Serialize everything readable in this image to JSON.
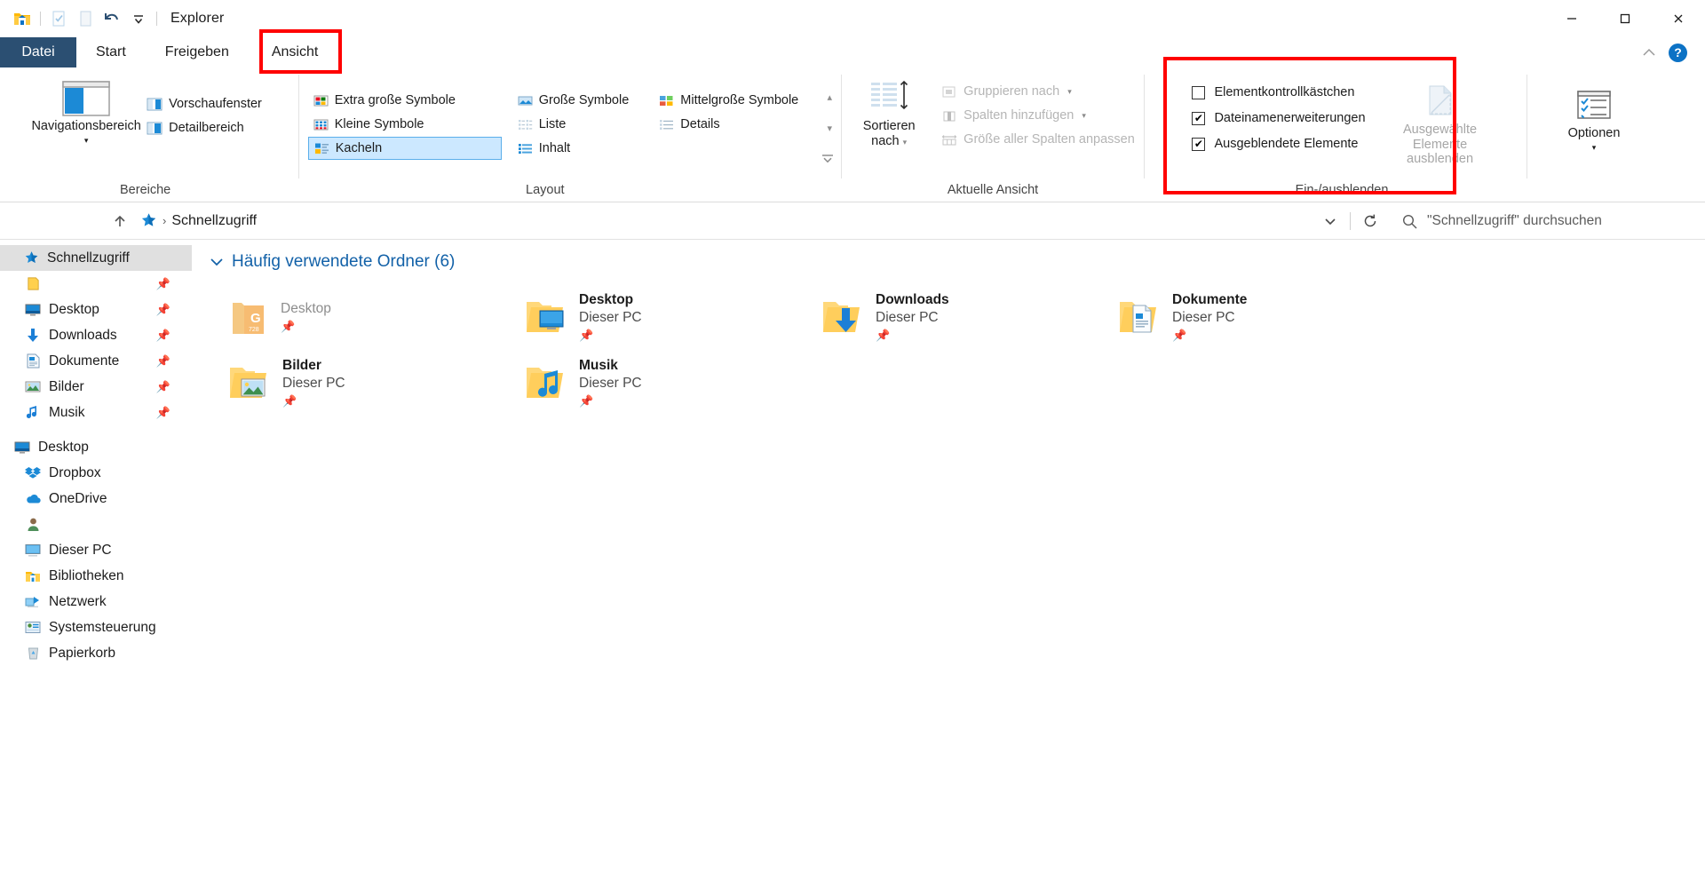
{
  "window": {
    "title": "Explorer",
    "quick_access_toolbar": [
      {
        "name": "explorer-icon",
        "label": "Explorer"
      },
      {
        "name": "properties-icon",
        "label": "Eigenschaften"
      },
      {
        "name": "new-folder-icon",
        "label": "Neuer Ordner"
      },
      {
        "name": "undo-icon",
        "label": "Rückgängig"
      },
      {
        "name": "customize-qat-caret",
        "label": "Symbolleiste anpassen"
      }
    ],
    "controls": {
      "minimize": "—",
      "maximize": "☐",
      "close": "✕"
    }
  },
  "tabs": [
    {
      "id": "datei",
      "label": "Datei",
      "kind": "file"
    },
    {
      "id": "start",
      "label": "Start",
      "kind": "normal"
    },
    {
      "id": "freigeben",
      "label": "Freigeben",
      "kind": "normal"
    },
    {
      "id": "ansicht",
      "label": "Ansicht",
      "kind": "normal",
      "highlighted": true
    }
  ],
  "tab_right": {
    "collapse_ribbon_caret": "⌃",
    "help_label": "?"
  },
  "ribbon": {
    "groups": [
      {
        "id": "bereiche",
        "label": "Bereiche",
        "big_button": {
          "label": "Navigationsbereich",
          "caret": "▾",
          "icon": "navigation-pane-icon"
        },
        "small_buttons": [
          {
            "label": "Vorschaufenster",
            "icon": "preview-pane-icon",
            "disabled": false
          },
          {
            "label": "Detailbereich",
            "icon": "details-pane-icon",
            "disabled": false
          }
        ]
      },
      {
        "id": "layout",
        "label": "Layout",
        "items": [
          {
            "label": "Extra große Symbole",
            "icon": "extra-large-icons-icon",
            "selected": false
          },
          {
            "label": "Kleine Symbole",
            "icon": "small-icons-icon",
            "selected": false
          },
          {
            "label": "Kacheln",
            "icon": "tiles-icon",
            "selected": true
          },
          {
            "label": "Große Symbole",
            "icon": "large-icons-icon",
            "selected": false
          },
          {
            "label": "Liste",
            "icon": "list-icon",
            "selected": false
          },
          {
            "label": "Inhalt",
            "icon": "content-icon",
            "selected": false
          },
          {
            "label": "Mittelgroße Symbole",
            "icon": "medium-icons-icon",
            "selected": false
          },
          {
            "label": "Details",
            "icon": "details-icon",
            "selected": false
          }
        ],
        "scroll_up": "▴",
        "scroll_down": "▾",
        "expand_more": "☰"
      },
      {
        "id": "aktuelle-ansicht",
        "label": "Aktuelle Ansicht",
        "big_button": {
          "label_line1": "Sortieren",
          "label_line2": "nach",
          "caret": "▾",
          "icon": "sort-by-icon"
        },
        "small_buttons": [
          {
            "label": "Gruppieren nach",
            "icon": "group-by-icon",
            "disabled": true,
            "caret": "▾"
          },
          {
            "label": "Spalten hinzufügen",
            "icon": "add-columns-icon",
            "disabled": true,
            "caret": "▾"
          },
          {
            "label": "Größe aller Spalten anpassen",
            "icon": "size-all-columns-icon",
            "disabled": true,
            "caret": ""
          }
        ]
      },
      {
        "id": "ein-ausblenden",
        "label": "Ein-/ausblenden",
        "highlighted": true,
        "checkboxes": [
          {
            "label": "Elementkontrollkästchen",
            "checked": false
          },
          {
            "label": "Dateinamenerweiterungen",
            "checked": true
          },
          {
            "label": "Ausgeblendete Elemente",
            "checked": true
          }
        ],
        "big_button": {
          "label_line1": "Ausgewählte",
          "label_line2": "Elemente ausblenden",
          "icon": "hide-selected-items-icon",
          "disabled": true
        }
      },
      {
        "id": "optionen",
        "label": "",
        "big_button": {
          "label": "Optionen",
          "caret": "▾",
          "icon": "options-icon",
          "disabled": false
        }
      }
    ]
  },
  "address_bar": {
    "up_button": "↑",
    "breadcrumb": [
      {
        "icon": "quick-access-star-icon",
        "label": ""
      },
      {
        "label": "Schnellzugriff"
      }
    ],
    "separator": "›",
    "history_caret": "⌄",
    "refresh_icon": "↻",
    "search_placeholder": "\"Schnellzugriff\" durchsuchen"
  },
  "sidebar": {
    "items": [
      {
        "label": "Schnellzugriff",
        "icon": "quick-access-star-icon",
        "level": 0,
        "selected": true,
        "pin": false
      },
      {
        "label": "",
        "icon": "folder-yellow-icon",
        "level": 1,
        "selected": false,
        "pin": true
      },
      {
        "label": "Desktop",
        "icon": "desktop-monitor-icon",
        "level": 1,
        "selected": false,
        "pin": true
      },
      {
        "label": "Downloads",
        "icon": "download-arrow-icon",
        "level": 1,
        "selected": false,
        "pin": true
      },
      {
        "label": "Dokumente",
        "icon": "document-icon",
        "level": 1,
        "selected": false,
        "pin": true
      },
      {
        "label": "Bilder",
        "icon": "pictures-icon",
        "level": 1,
        "selected": false,
        "pin": true
      },
      {
        "label": "Musik",
        "icon": "music-note-icon",
        "level": 1,
        "selected": false,
        "pin": true
      },
      {
        "label": "Desktop",
        "icon": "desktop-monitor-icon",
        "level": 0,
        "selected": false,
        "pin": false
      },
      {
        "label": "Dropbox",
        "icon": "dropbox-icon",
        "level": 1,
        "selected": false,
        "pin": false
      },
      {
        "label": "OneDrive",
        "icon": "onedrive-cloud-icon",
        "level": 1,
        "selected": false,
        "pin": false
      },
      {
        "label": "",
        "icon": "user-account-icon",
        "level": 1,
        "selected": false,
        "pin": false
      },
      {
        "label": "Dieser PC",
        "icon": "this-pc-icon",
        "level": 1,
        "selected": false,
        "pin": false
      },
      {
        "label": "Bibliotheken",
        "icon": "libraries-icon",
        "level": 1,
        "selected": false,
        "pin": false
      },
      {
        "label": "Netzwerk",
        "icon": "network-icon",
        "level": 1,
        "selected": false,
        "pin": false
      },
      {
        "label": "Systemsteuerung",
        "icon": "control-panel-icon",
        "level": 1,
        "selected": false,
        "pin": false
      },
      {
        "label": "Papierkorb",
        "icon": "recycle-bin-icon",
        "level": 1,
        "selected": false,
        "pin": false
      }
    ]
  },
  "main": {
    "group_header": {
      "caret": "⌄",
      "title": "Häufig verwendete Ordner (6)"
    },
    "tiles": [
      {
        "name": "Desktop",
        "sub": "",
        "icon": "folder-orange-g-icon",
        "pinned": true,
        "hidden": true
      },
      {
        "name": "Desktop",
        "sub": "Dieser PC",
        "icon": "folder-desktop-icon",
        "pinned": true,
        "hidden": false
      },
      {
        "name": "Downloads",
        "sub": "Dieser PC",
        "icon": "folder-downloads-icon",
        "pinned": true,
        "hidden": false
      },
      {
        "name": "Dokumente",
        "sub": "Dieser PC",
        "icon": "folder-documents-icon",
        "pinned": true,
        "hidden": false
      },
      {
        "name": "Bilder",
        "sub": "Dieser PC",
        "icon": "folder-pictures-icon",
        "pinned": true,
        "hidden": false
      },
      {
        "name": "Musik",
        "sub": "Dieser PC",
        "icon": "folder-music-icon",
        "pinned": true,
        "hidden": false
      }
    ],
    "pin_glyph": "📌"
  },
  "colors": {
    "accent": "#0c72c5",
    "selection": "#cce8ff",
    "selection_border": "#5aaeea",
    "annotation": "#ff0000",
    "group_header": "#1261a8",
    "folder_yellow": "#ffd04d"
  }
}
